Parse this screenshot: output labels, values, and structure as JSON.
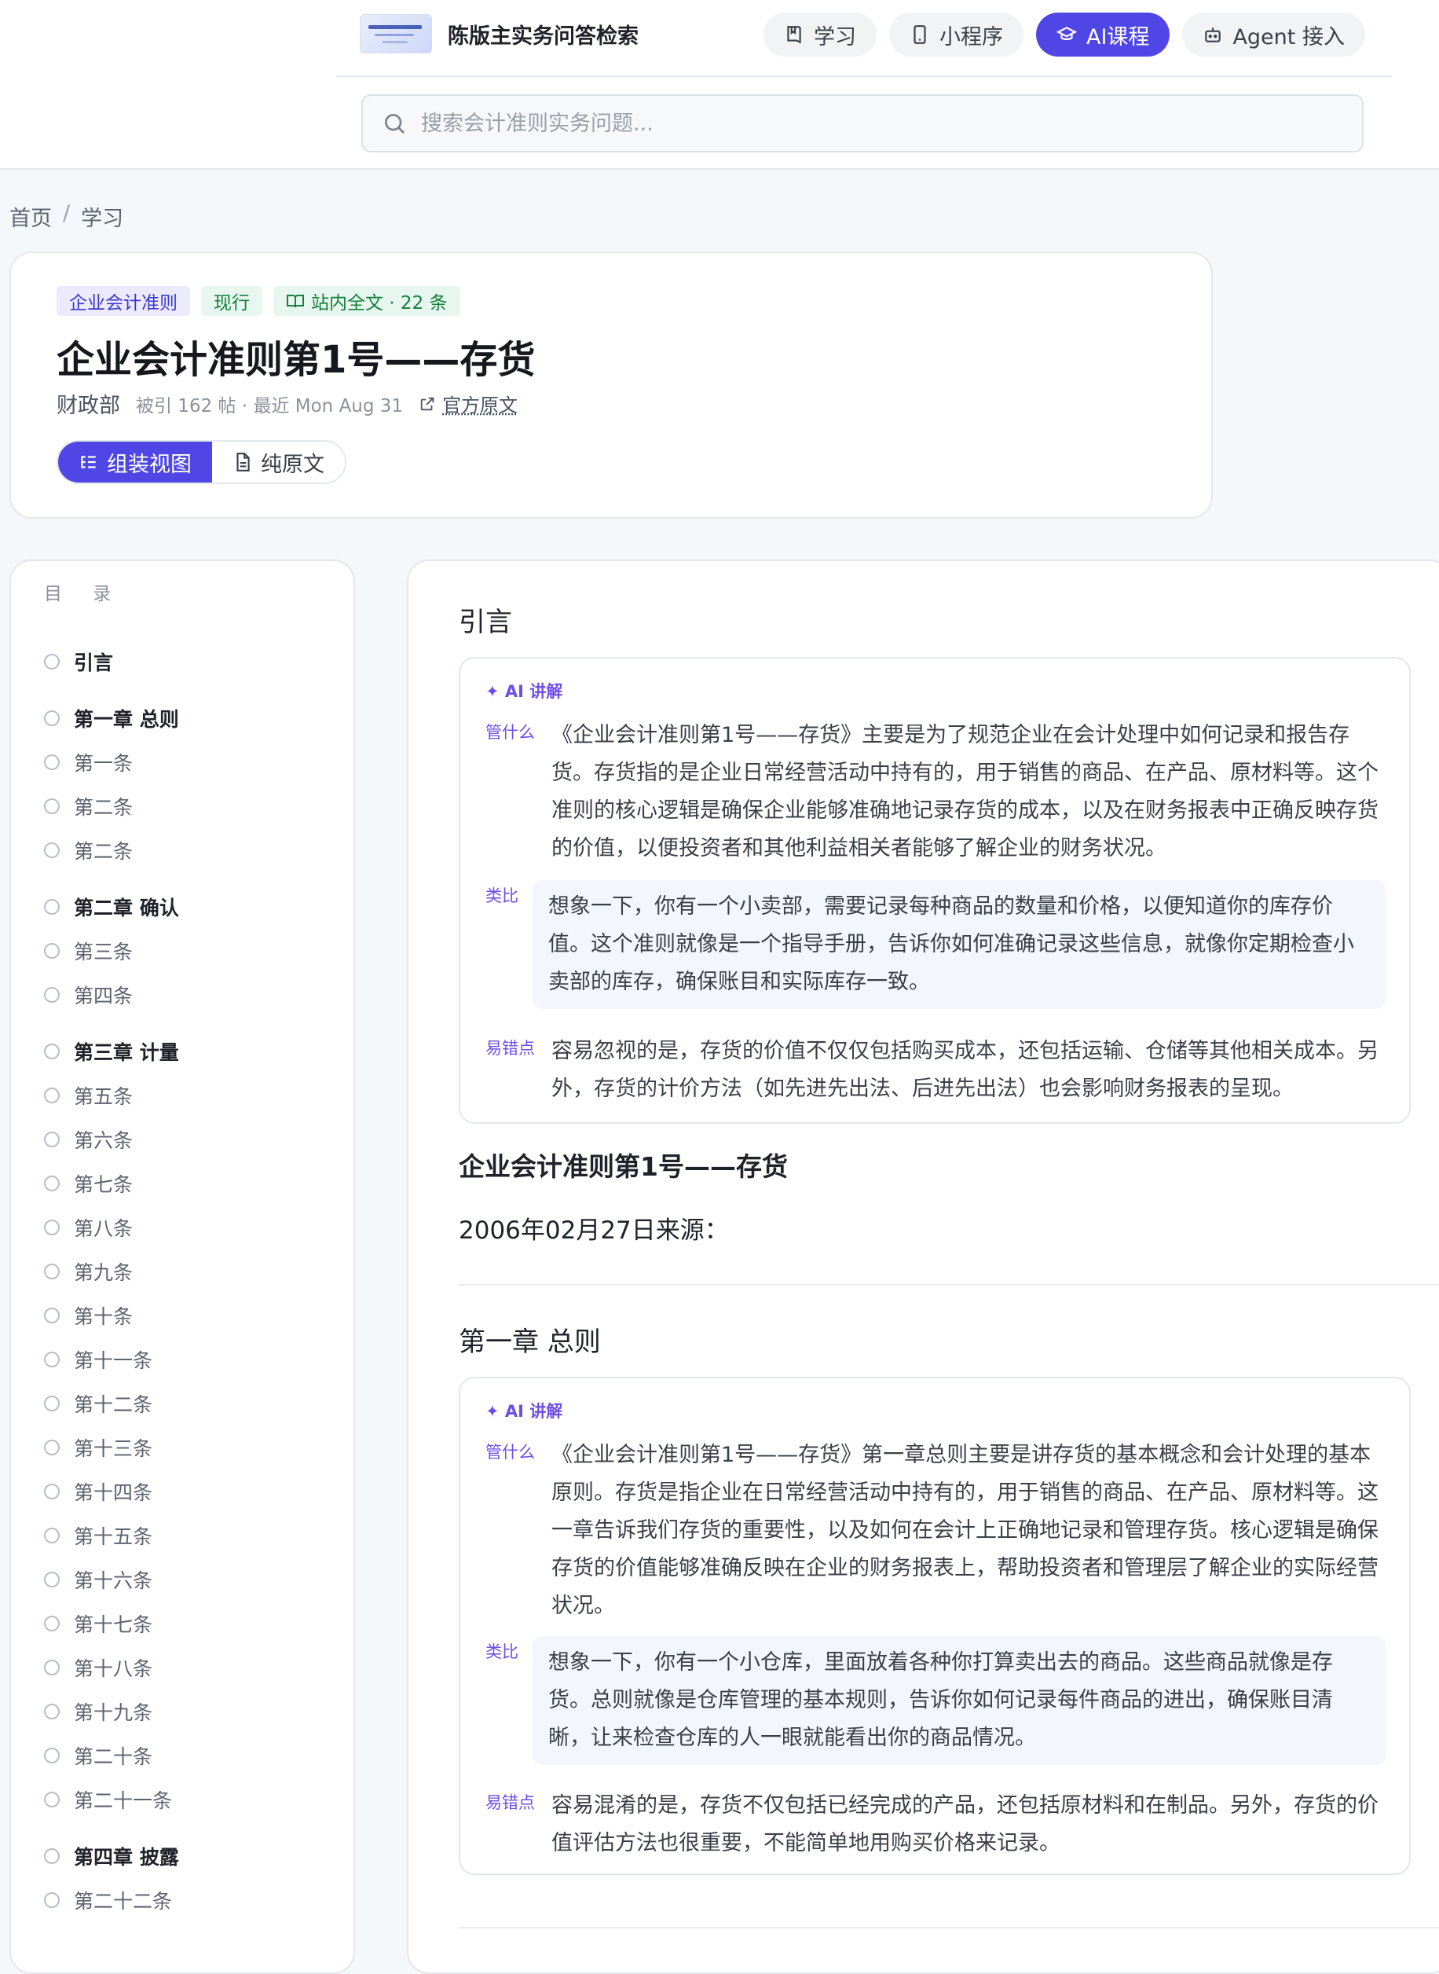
{
  "header": {
    "brand_title": "陈版主实务问答检索",
    "nav": [
      {
        "label": "学习",
        "icon": "book-icon",
        "active": false
      },
      {
        "label": "小程序",
        "icon": "phone-icon",
        "active": false
      },
      {
        "label": "AI课程",
        "icon": "graduation-cap-icon",
        "active": true
      },
      {
        "label": "Agent 接入",
        "icon": "robot-icon",
        "active": false
      }
    ],
    "search_placeholder": "搜索会计准则实务问题...",
    "accent_color": "#4f46e5"
  },
  "breadcrumb": {
    "home": "首页",
    "separator": "/",
    "current": "学习"
  },
  "standard": {
    "tags": [
      "企业会计准则",
      "现行",
      "站内全文 · 22 条"
    ],
    "title": "企业会计准则第1号——存货",
    "publisher": "财政部",
    "citation": "被引 162 帖 · 最近 Mon Aug 31",
    "source_link": "官方原文",
    "view_modes": [
      {
        "label": "组装视图",
        "active": true
      },
      {
        "label": "纯原文",
        "active": false
      }
    ]
  },
  "toc": {
    "title": "目 录",
    "items": [
      {
        "label": "引言",
        "type": "chapter"
      },
      {
        "label": "第一章 总则",
        "type": "chapter"
      },
      {
        "label": "第一条",
        "type": "article"
      },
      {
        "label": "第二条",
        "type": "article"
      },
      {
        "label": "第二条",
        "type": "article"
      },
      {
        "label": "第二章 确认",
        "type": "chapter"
      },
      {
        "label": "第三条",
        "type": "article"
      },
      {
        "label": "第四条",
        "type": "article"
      },
      {
        "label": "第三章 计量",
        "type": "chapter"
      },
      {
        "label": "第五条",
        "type": "article"
      },
      {
        "label": "第六条",
        "type": "article"
      },
      {
        "label": "第七条",
        "type": "article"
      },
      {
        "label": "第八条",
        "type": "article"
      },
      {
        "label": "第九条",
        "type": "article"
      },
      {
        "label": "第十条",
        "type": "article"
      },
      {
        "label": "第十一条",
        "type": "article"
      },
      {
        "label": "第十二条",
        "type": "article"
      },
      {
        "label": "第十三条",
        "type": "article"
      },
      {
        "label": "第十四条",
        "type": "article"
      },
      {
        "label": "第十五条",
        "type": "article"
      },
      {
        "label": "第十六条",
        "type": "article"
      },
      {
        "label": "第十七条",
        "type": "article"
      },
      {
        "label": "第十八条",
        "type": "article"
      },
      {
        "label": "第十九条",
        "type": "article"
      },
      {
        "label": "第二十条",
        "type": "article"
      },
      {
        "label": "第二十一条",
        "type": "article"
      },
      {
        "label": "第四章 披露",
        "type": "chapter"
      },
      {
        "label": "第二十二条",
        "type": "article"
      }
    ]
  },
  "content": {
    "ai_label": "✦ AI 讲解",
    "row_labels": {
      "what": "管什么",
      "analogy": "类比",
      "pitfall": "易错点"
    },
    "sections": [
      {
        "heading": "引言",
        "what": "《企业会计准则第1号——存货》主要是为了规范企业在会计处理中如何记录和报告存货。存货指的是企业日常经营活动中持有的，用于销售的商品、在产品、原材料等。这个准则的核心逻辑是确保企业能够准确地记录存货的成本，以及在财务报表中正确反映存货的价值，以便投资者和其他利益相关者能够了解企业的财务状况。",
        "analogy": "想象一下，你有一个小卖部，需要记录每种商品的数量和价格，以便知道你的库存价值。这个准则就像是一个指导手册，告诉你如何准确记录这些信息，就像你定期检查小卖部的库存，确保账目和实际库存一致。",
        "pitfall": "容易忽视的是，存货的价值不仅仅包括购买成本，还包括运输、仓储等其他相关成本。另外，存货的计价方法（如先进先出法、后进先出法）也会影响财务报表的呈现。",
        "doc_title": "企业会计准则第1号——存货",
        "doc_date": "2006年02月27日来源："
      },
      {
        "heading": "第一章 总则",
        "what": "《企业会计准则第1号——存货》第一章总则主要是讲存货的基本概念和会计处理的基本原则。存货是指企业在日常经营活动中持有的，用于销售的商品、在产品、原材料等。这一章告诉我们存货的重要性，以及如何在会计上正确地记录和管理存货。核心逻辑是确保存货的价值能够准确反映在企业的财务报表上，帮助投资者和管理层了解企业的实际经营状况。",
        "analogy": "想象一下，你有一个小仓库，里面放着各种你打算卖出去的商品。这些商品就像是存货。总则就像是仓库管理的基本规则，告诉你如何记录每件商品的进出，确保账目清晰，让来检查仓库的人一眼就能看出你的商品情况。",
        "pitfall": "容易混淆的是，存货不仅包括已经完成的产品，还包括原材料和在制品。另外，存货的价值评估方法也很重要，不能简单地用购买价格来记录。"
      }
    ]
  }
}
